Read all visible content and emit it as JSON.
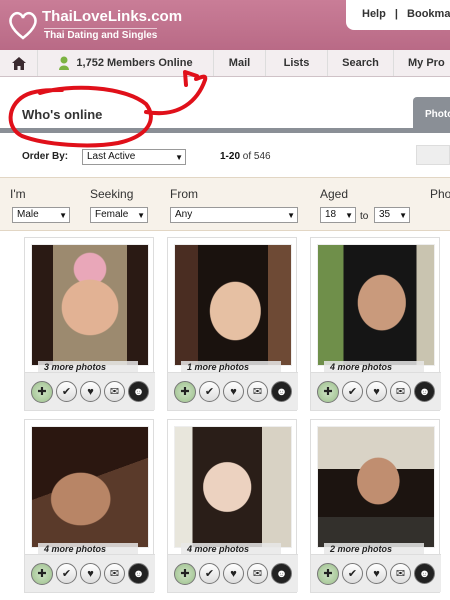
{
  "brand": {
    "name": "ThaiLoveLinks.com",
    "tagline": "Thai Dating and Singles"
  },
  "toplinks": {
    "help": "Help",
    "sep": "|",
    "bookmark": "Bookmar"
  },
  "nav": {
    "online": "1,752 Members Online",
    "mail": "Mail",
    "lists": "Lists",
    "search": "Search",
    "profile": "My Pro"
  },
  "page": {
    "title": "Who's online",
    "tab": "Photo"
  },
  "sort": {
    "label": "Order By:",
    "value": "Last Active",
    "range": "1-20",
    "of": "of 546"
  },
  "filters": {
    "im_label": "I'm",
    "im_value": "Male",
    "seeking_label": "Seeking",
    "seeking_value": "Female",
    "from_label": "From",
    "from_value": "Any",
    "aged_label": "Aged",
    "aged_min": "18",
    "to": "to",
    "aged_max": "35",
    "extra_label": "Pho"
  },
  "members": [
    {
      "photos_text": "3 more photos"
    },
    {
      "photos_text": "1 more photos"
    },
    {
      "photos_text": "4 more photos"
    },
    {
      "photos_text": "4 more photos"
    },
    {
      "photos_text": "4 more photos"
    },
    {
      "photos_text": "2 more photos"
    }
  ],
  "colors": {
    "header": "#c97d97",
    "annotation": "#e0101a",
    "tab": "#8a8f96"
  }
}
